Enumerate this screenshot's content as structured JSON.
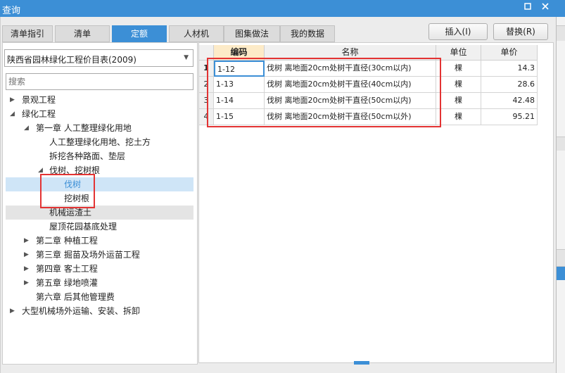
{
  "window": {
    "title": "查询"
  },
  "tabs": [
    {
      "label": "清单指引"
    },
    {
      "label": "清单"
    },
    {
      "label": "定额"
    },
    {
      "label": "人材机"
    },
    {
      "label": "图集做法"
    },
    {
      "label": "我的数据"
    }
  ],
  "buttons": {
    "insert": "插入(I)",
    "replace": "替换(R)"
  },
  "library": {
    "selected": "陕西省园林绿化工程价目表(2009)"
  },
  "search": {
    "placeholder": "搜索"
  },
  "tree": [
    {
      "label": "景观工程",
      "level": 0,
      "toggle": "▶"
    },
    {
      "label": "绿化工程",
      "level": 0,
      "toggle": "◢"
    },
    {
      "label": "第一章 人工整理绿化用地",
      "level": 1,
      "toggle": "◢"
    },
    {
      "label": "人工整理绿化用地、挖土方",
      "level": 2,
      "toggle": ""
    },
    {
      "label": "拆挖各种路面、垫层",
      "level": 2,
      "toggle": ""
    },
    {
      "label": "伐树、挖树根",
      "level": 2,
      "toggle": "◢"
    },
    {
      "label": "伐树",
      "level": 3,
      "toggle": "",
      "state": "selected"
    },
    {
      "label": "挖树根",
      "level": 3,
      "toggle": ""
    },
    {
      "label": "机械运渣土",
      "level": 2,
      "toggle": "",
      "state": "hover"
    },
    {
      "label": "屋顶花园基底处理",
      "level": 2,
      "toggle": ""
    },
    {
      "label": "第二章 种植工程",
      "level": 1,
      "toggle": "▶"
    },
    {
      "label": "第三章 掘苗及场外运苗工程",
      "level": 1,
      "toggle": "▶"
    },
    {
      "label": "第四章 客土工程",
      "level": 1,
      "toggle": "▶"
    },
    {
      "label": "第五章 绿地喷灌",
      "level": 1,
      "toggle": "▶"
    },
    {
      "label": "第六章 后其他管理费",
      "level": 1,
      "toggle": ""
    },
    {
      "label": "大型机械场外运输、安装、拆卸",
      "level": 0,
      "toggle": "▶"
    }
  ],
  "table": {
    "columns": [
      "编码",
      "名称",
      "单位",
      "单价"
    ],
    "rows": [
      {
        "num": "1",
        "code": "1-12",
        "name": "伐树 离地面20cm处树干直径(30cm以内)",
        "unit": "棵",
        "price": "14.3"
      },
      {
        "num": "2",
        "code": "1-13",
        "name": "伐树 离地面20cm处树干直径(40cm以内)",
        "unit": "棵",
        "price": "28.6"
      },
      {
        "num": "3",
        "code": "1-14",
        "name": "伐树 离地面20cm处树干直径(50cm以内)",
        "unit": "棵",
        "price": "42.48"
      },
      {
        "num": "4",
        "code": "1-15",
        "name": "伐树 离地面20cm处树干直径(50cm以外)",
        "unit": "棵",
        "price": "95.21"
      }
    ]
  },
  "colors": {
    "accent": "#3c8fd6",
    "highlight": "#e33333",
    "selected_row": "#cfe5f7"
  }
}
